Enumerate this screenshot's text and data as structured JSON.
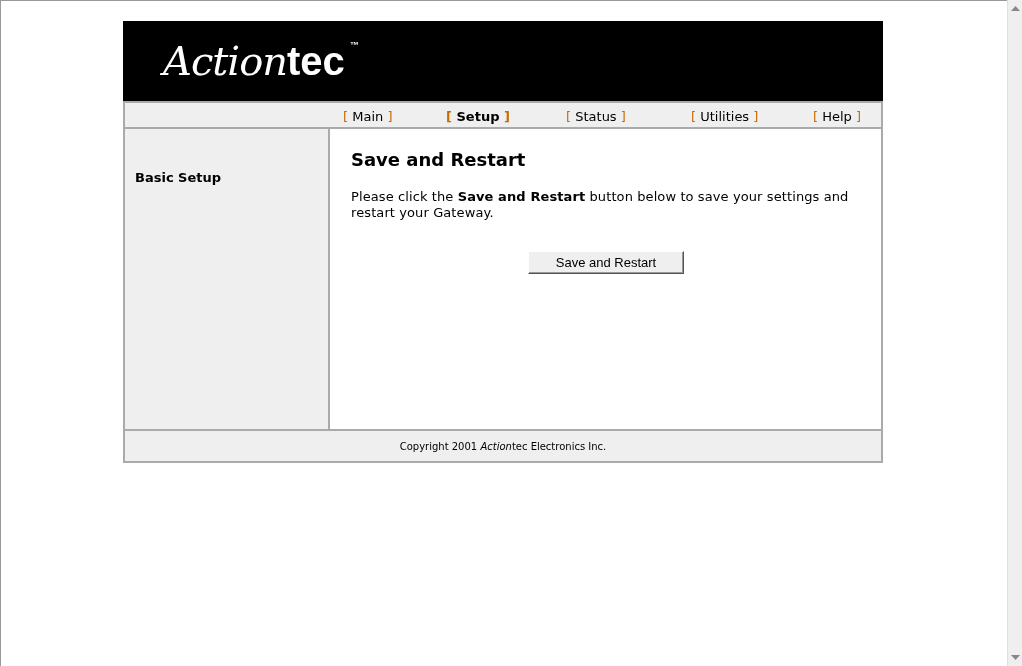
{
  "header": {
    "logo": {
      "script": "Action",
      "bold": "tec",
      "mark": "™"
    }
  },
  "nav": [
    {
      "label": "Main",
      "selected": false
    },
    {
      "label": "Setup",
      "selected": true
    },
    {
      "label": "Status",
      "selected": false
    },
    {
      "label": "Utilities",
      "selected": false
    },
    {
      "label": "Help",
      "selected": false
    }
  ],
  "nav_brackets": {
    "open": "[",
    "close": "]"
  },
  "sidebar": {
    "items": [
      "Basic Setup"
    ]
  },
  "content": {
    "title": "Save and Restart",
    "text": "Please click the **Save and Restart** button below to save your settings and restart your Gateway.",
    "button": "Save and Restart"
  },
  "footer": {
    "copyright": {
      "before": "Copyright 2001 ",
      "italic": "Action",
      "after": "tec Electronics Inc."
    }
  }
}
